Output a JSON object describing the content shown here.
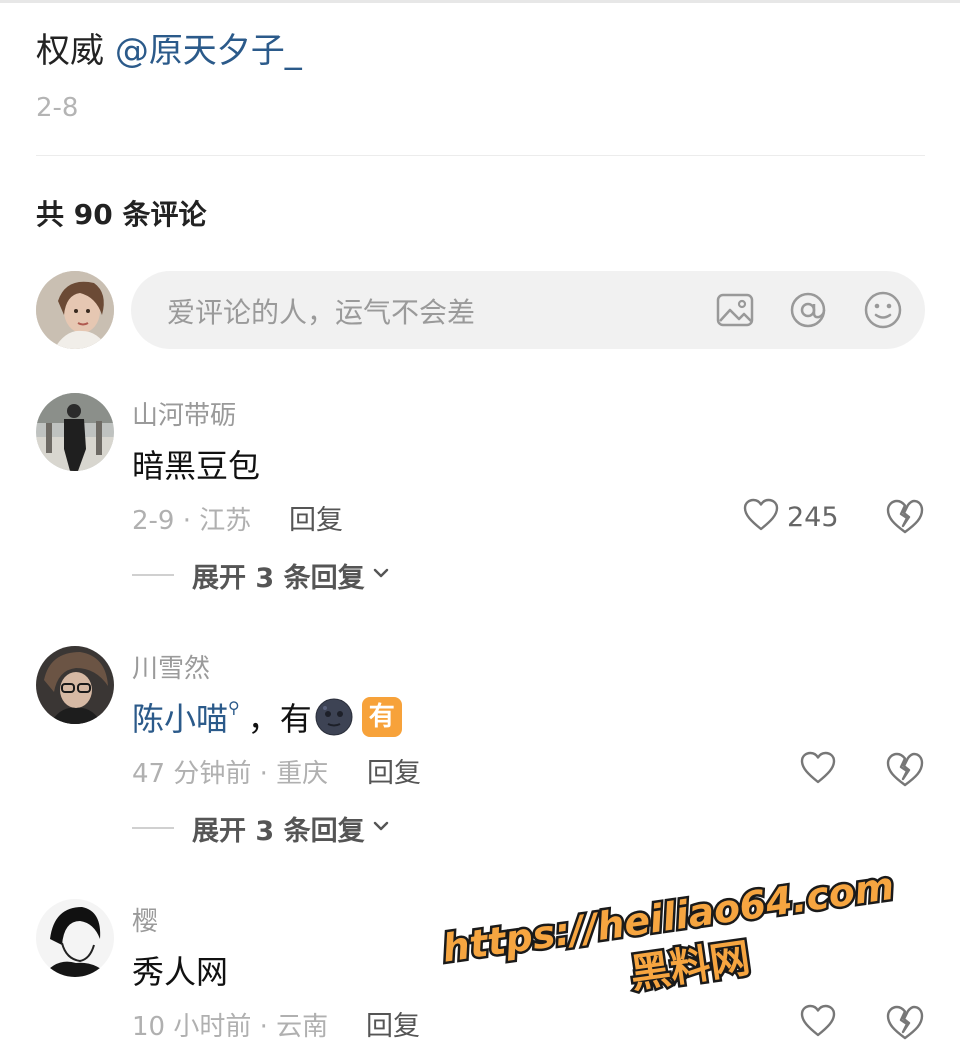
{
  "post": {
    "text_prefix": "权威 ",
    "mention": "@原天夕子_",
    "date": "2-8"
  },
  "comments_header": {
    "count_label": "共 90 条评论"
  },
  "comment_input": {
    "placeholder": "爱评论的人，运气不会差",
    "icons": [
      "image-icon",
      "at-icon",
      "emoji-icon"
    ]
  },
  "comments": [
    {
      "author": "山河带砺",
      "text": "暗黑豆包",
      "meta": "2-9 · 江苏",
      "reply_label": "回复",
      "like_count": "245",
      "expand_label": "展开 3 条回复"
    },
    {
      "author": "川雪然",
      "mention": "陈小喵",
      "text_suffix": "，有",
      "badge": "有",
      "meta": "47 分钟前 · 重庆",
      "reply_label": "回复",
      "like_count": "",
      "expand_label": "展开 3 条回复"
    },
    {
      "author": "樱",
      "text": "秀人网",
      "meta": "10 小时前 · 云南",
      "reply_label": "回复",
      "like_count": ""
    }
  ],
  "watermark": {
    "line1": "https://heiliao64.com",
    "line2": "黑料网"
  },
  "colors": {
    "mention": "#2b5a8a",
    "watermark_fill": "#f6a540",
    "badge": "#f7a23a"
  }
}
